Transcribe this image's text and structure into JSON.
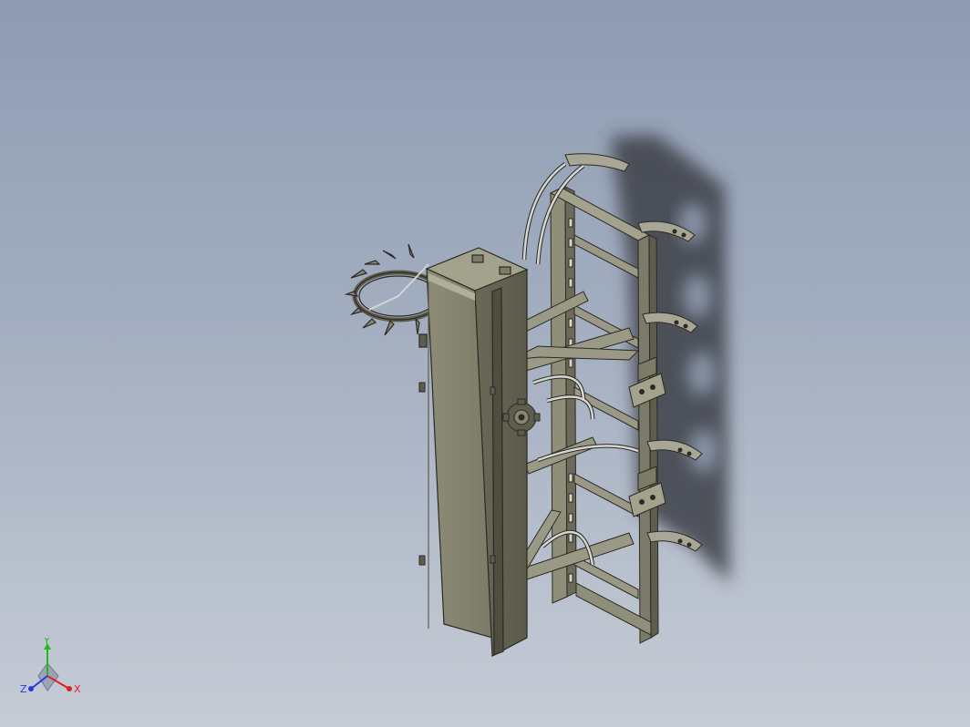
{
  "viewport": {
    "background_top": "#8e9bb2",
    "background_bottom": "#c6ccd6"
  },
  "model": {
    "body_color": "#878672",
    "body_dark": "#5f5e4e",
    "body_light": "#a3a28d",
    "edge_color": "#2b2a24",
    "shadow_color": "#3c3f47",
    "tube_color": "#d6d6d2"
  },
  "triad": {
    "x_label": "X",
    "y_label": "Y",
    "z_label": "Z",
    "x_color": "#e02020",
    "y_color": "#22b822",
    "z_color": "#2a3ad8"
  }
}
